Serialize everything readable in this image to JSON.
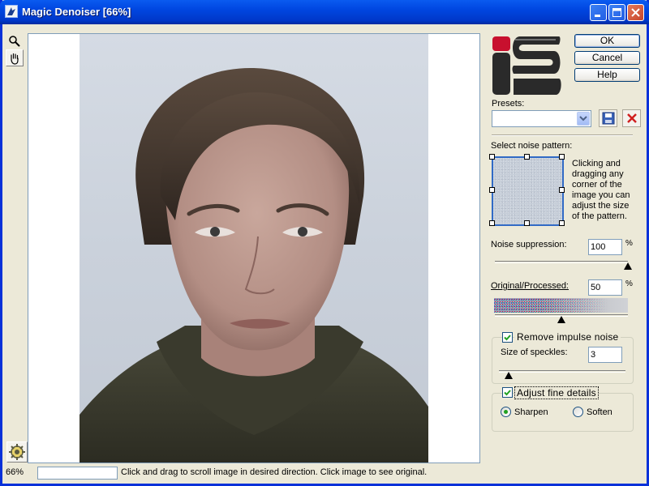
{
  "window": {
    "title": "Magic Denoiser [66%]",
    "icon": "app-logo-icon"
  },
  "tools": [
    {
      "name": "zoom-tool",
      "icon": "magnifier-icon"
    },
    {
      "name": "hand-tool",
      "icon": "hand-icon",
      "pressed": true
    }
  ],
  "buttons": {
    "ok": "OK",
    "cancel": "Cancel",
    "help": "Help"
  },
  "presets": {
    "label": "Presets:",
    "value": ""
  },
  "noise_pattern": {
    "label": "Select noise pattern:",
    "help": "Clicking and dragging any corner of the image you can adjust the size of the pattern."
  },
  "noise_suppression": {
    "label": "Noise suppression:",
    "value": "100",
    "unit": "%",
    "level": 1.0
  },
  "original_processed": {
    "label": "Original/Processed:",
    "value": "50",
    "unit": "%",
    "level": 0.5
  },
  "impulse": {
    "label": "Remove impulse noise",
    "checked": true,
    "speckles_label": "Size of speckles:",
    "speckles_value": "3",
    "level": 0.08
  },
  "fine_details": {
    "label": "Adjust fine details",
    "checked": true,
    "options": [
      "Sharpen",
      "Soften"
    ],
    "selected": "Sharpen"
  },
  "status_bar": {
    "zoom": "66%",
    "hint": "Click and drag to scroll image in desired direction. Click image to see original."
  },
  "colors": {
    "title_bar": "#0046e0",
    "window_bg": "#ece9d8",
    "accent_red": "#c8102e"
  }
}
